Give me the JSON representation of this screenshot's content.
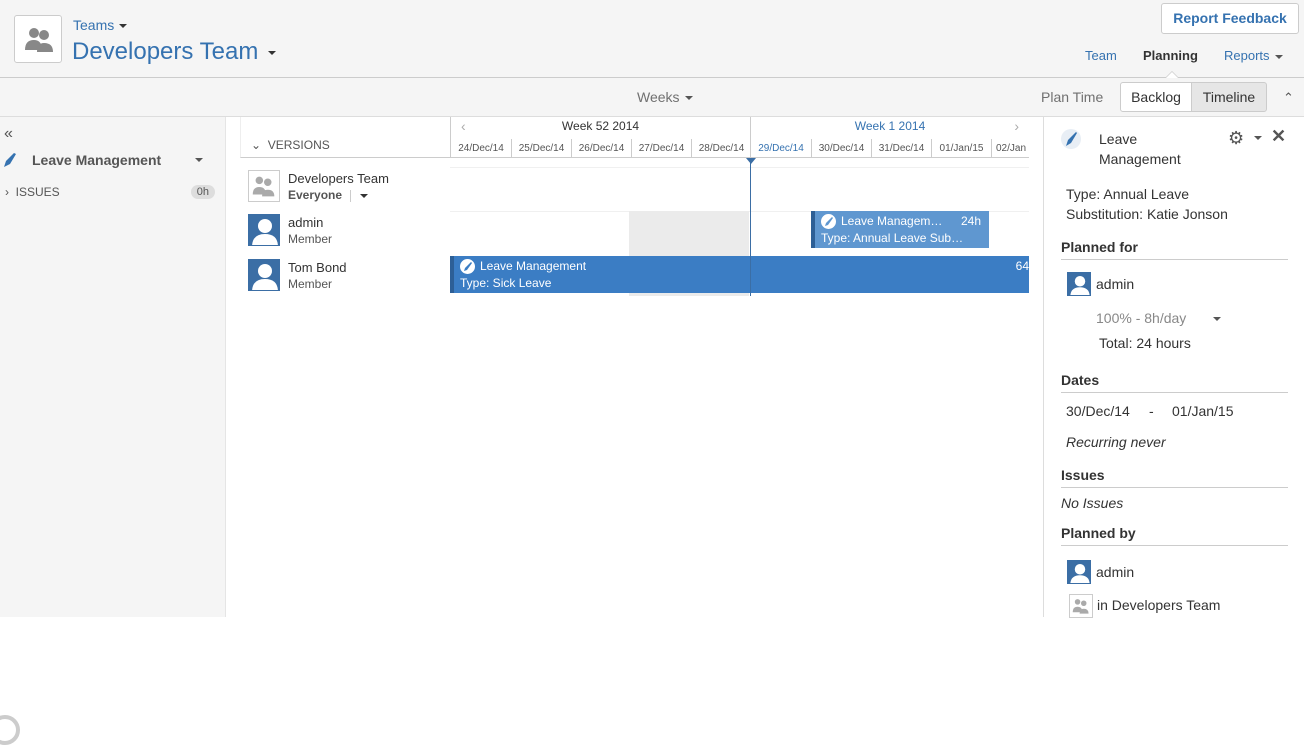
{
  "header": {
    "breadcrumb": "Teams",
    "title": "Developers Team",
    "feedback_button": "Report Feedback",
    "tabs": [
      "Team",
      "Planning",
      "Reports"
    ]
  },
  "toolbar": {
    "scale": "Weeks",
    "plan_time": "Plan Time",
    "backlog": "Backlog",
    "timeline": "Timeline"
  },
  "sidebar": {
    "collapse": "«",
    "project": "Leave Management",
    "issues_label": "ISSUES",
    "issues_hours": "0h"
  },
  "grid": {
    "versions_label": "VERSIONS",
    "weeks": [
      {
        "title": "Week 52 2014",
        "days": [
          "24/Dec/14",
          "25/Dec/14",
          "26/Dec/14",
          "27/Dec/14",
          "28/Dec/14"
        ]
      },
      {
        "title": "Week 1 2014",
        "days": [
          "29/Dec/14",
          "30/Dec/14",
          "31/Dec/14",
          "01/Jan/15",
          "02/Jan"
        ]
      }
    ],
    "rows": [
      {
        "name": "Developers Team",
        "role": "Everyone"
      },
      {
        "name": "admin",
        "role": "Member"
      },
      {
        "name": "Tom Bond",
        "role": "Member"
      }
    ],
    "bars": [
      {
        "title": "Leave Managem…",
        "hours": "24h",
        "subtitle": "Type: Annual Leave Sub…"
      },
      {
        "title": "Leave Management",
        "hours": "64",
        "subtitle": "Type: Sick Leave"
      }
    ]
  },
  "panel": {
    "title": "Leave Management",
    "type": "Type: Annual Leave",
    "substitution": "Substitution: Katie Jonson",
    "planned_for_heading": "Planned for",
    "planned_for_user": "admin",
    "allocation": "100%",
    "allocation_rate": " - 8h/day",
    "total": "Total: 24 hours",
    "dates_heading": "Dates",
    "date_start": "30/Dec/14",
    "date_sep": "-",
    "date_end": "01/Jan/15",
    "recurring": "Recurring never",
    "issues_heading": "Issues",
    "no_issues": "No Issues",
    "planned_by_heading": "Planned by",
    "planned_by_user": "admin",
    "planned_by_team": "in Developers Team"
  }
}
